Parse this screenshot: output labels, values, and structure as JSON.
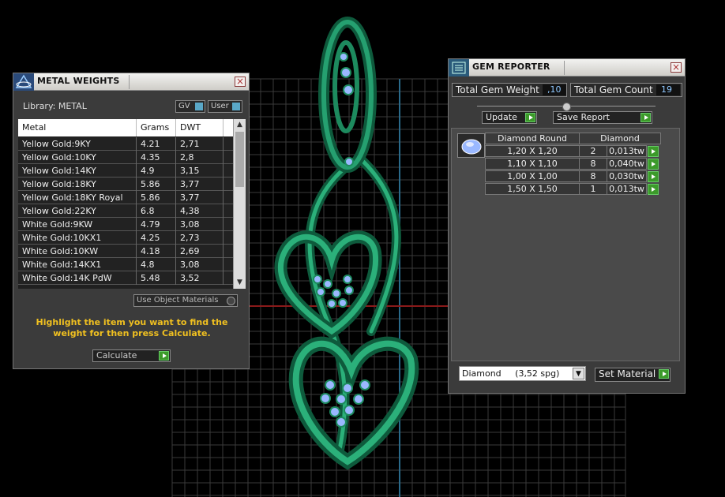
{
  "metal_weights": {
    "title": "METAL WEIGHTS",
    "library_label": "Library: METAL",
    "gv_label": "GV",
    "user_label": "User",
    "columns": [
      "Metal",
      "Grams",
      "DWT"
    ],
    "rows": [
      {
        "metal": "Yellow Gold:9KY",
        "grams": "4.21",
        "dwt": "2,71"
      },
      {
        "metal": "Yellow Gold:10KY",
        "grams": "4.35",
        "dwt": "2,8"
      },
      {
        "metal": "Yellow Gold:14KY",
        "grams": "4.9",
        "dwt": "3,15"
      },
      {
        "metal": "Yellow Gold:18KY",
        "grams": "5.86",
        "dwt": "3,77"
      },
      {
        "metal": "Yellow Gold:18KY Royal",
        "grams": "5.86",
        "dwt": "3,77"
      },
      {
        "metal": "Yellow Gold:22KY",
        "grams": "6.8",
        "dwt": "4,38"
      },
      {
        "metal": "White Gold:9KW",
        "grams": "4.79",
        "dwt": "3,08"
      },
      {
        "metal": "White Gold:10KX1",
        "grams": "4.25",
        "dwt": "2,73"
      },
      {
        "metal": "White Gold:10KW",
        "grams": "4.18",
        "dwt": "2,69"
      },
      {
        "metal": "White Gold:14KX1",
        "grams": "4.8",
        "dwt": "3,08"
      },
      {
        "metal": "White Gold:14K PdW",
        "grams": "5.48",
        "dwt": "3,52"
      }
    ],
    "use_object_materials_label": "Use Object Materials",
    "instruction": "Highlight the item you want to find the weight for then press Calculate.",
    "calculate_label": "Calculate"
  },
  "gem_reporter": {
    "title": "GEM REPORTER",
    "total_weight_label": "Total Gem Weight",
    "total_weight_value": ",10",
    "total_count_label": "Total Gem Count",
    "total_count_value": "19",
    "update_label": "Update",
    "save_report_label": "Save Report",
    "table_headers": [
      "Diamond Round",
      "Diamond"
    ],
    "rows": [
      {
        "size": "1,20 X 1,20",
        "count": "2",
        "weight": "0,013tw"
      },
      {
        "size": "1,10 X 1,10",
        "count": "8",
        "weight": "0,040tw"
      },
      {
        "size": "1,00 X 1,00",
        "count": "8",
        "weight": "0,030tw"
      },
      {
        "size": "1,50 X 1,50",
        "count": "1",
        "weight": "0,013tw"
      }
    ],
    "material_select": "Diamond     (3,52 spg)",
    "set_material_label": "Set Material"
  },
  "colors": {
    "accent_green": "#3c9a2a",
    "instruction_yellow": "#f0c020",
    "value_blue": "#8fc8ff",
    "jewel_green": "#1a8a5a"
  }
}
